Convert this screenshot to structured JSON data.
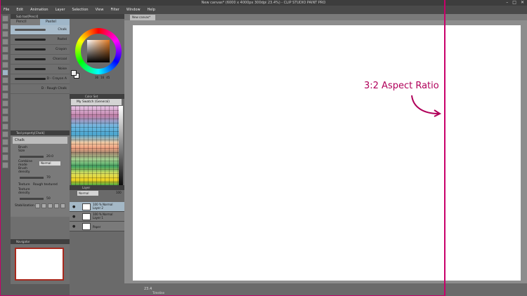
{
  "window": {
    "title": "New canvas* (6000 x 4000px 300dpi 23.4%) - CLIP STUDIO PAINT PRO"
  },
  "menu": [
    "File",
    "Edit",
    "Animation",
    "Layer",
    "Selection",
    "View",
    "Filter",
    "Window",
    "Help"
  ],
  "subtool": {
    "header": "Sub tool[Pencil]",
    "tabs": [
      "Pencil",
      "Pastel"
    ],
    "brushes": [
      "Chalk",
      "Pastel",
      "Crayon",
      "Charcoal",
      "Noise",
      "D - Crayon A",
      "D - Rough Chalk"
    ]
  },
  "tool_property": {
    "header": "Tool property[Chalk]",
    "name": "Chalk",
    "brush_size_label": "Brush Size",
    "brush_size_value": "20.0",
    "combine_mode_label": "Combine mode",
    "combine_mode_value": "Normal",
    "brush_density_label": "Brush density",
    "brush_density_value": "70",
    "texture_label": "Texture",
    "texture_value": "Rough textured",
    "texture_density_label": "Texture density",
    "texture_density_value": "50",
    "stabilization_label": "Stabilization"
  },
  "navigator": {
    "header": "Navigator"
  },
  "color": {
    "hsv": [
      "36",
      "16",
      "45"
    ],
    "colorset_header": "Color Set",
    "colorset_name": "My Swatch (General)"
  },
  "layers": {
    "header": "Layer",
    "blend": "Normal",
    "opacity": "100",
    "rows": [
      {
        "line1": "100 %  Normal",
        "line2": "Layer 2"
      },
      {
        "line1": "100 %  Normal",
        "line2": "Layer 1"
      },
      {
        "line1": "",
        "line2": "Paper"
      }
    ]
  },
  "canvas": {
    "tab": "New canvas*",
    "zoom": "23.4",
    "timeline": "Timeline"
  },
  "annotation": {
    "text": "3:2 Aspect Ratio"
  },
  "colors": {
    "accent": "#c8006a",
    "selection": "#9fb6c8"
  }
}
